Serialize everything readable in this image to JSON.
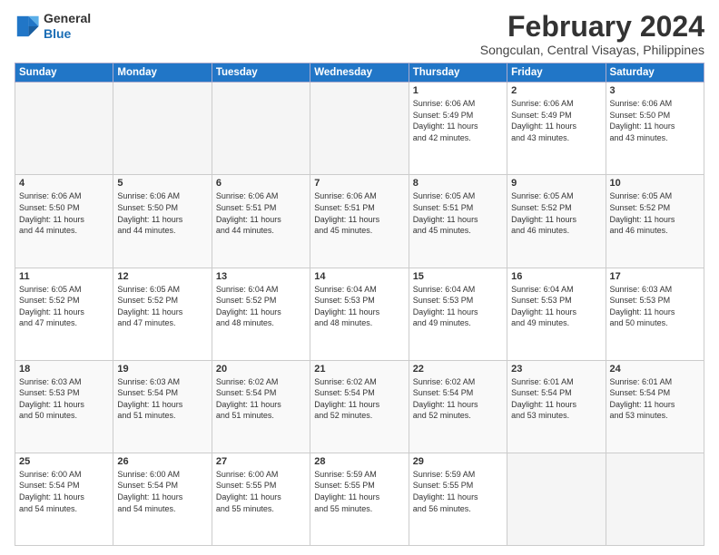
{
  "logo": {
    "line1": "General",
    "line2": "Blue"
  },
  "title": "February 2024",
  "subtitle": "Songculan, Central Visayas, Philippines",
  "days_header": [
    "Sunday",
    "Monday",
    "Tuesday",
    "Wednesday",
    "Thursday",
    "Friday",
    "Saturday"
  ],
  "weeks": [
    [
      {
        "day": "",
        "info": ""
      },
      {
        "day": "",
        "info": ""
      },
      {
        "day": "",
        "info": ""
      },
      {
        "day": "",
        "info": ""
      },
      {
        "day": "1",
        "info": "Sunrise: 6:06 AM\nSunset: 5:49 PM\nDaylight: 11 hours\nand 42 minutes."
      },
      {
        "day": "2",
        "info": "Sunrise: 6:06 AM\nSunset: 5:49 PM\nDaylight: 11 hours\nand 43 minutes."
      },
      {
        "day": "3",
        "info": "Sunrise: 6:06 AM\nSunset: 5:50 PM\nDaylight: 11 hours\nand 43 minutes."
      }
    ],
    [
      {
        "day": "4",
        "info": "Sunrise: 6:06 AM\nSunset: 5:50 PM\nDaylight: 11 hours\nand 44 minutes."
      },
      {
        "day": "5",
        "info": "Sunrise: 6:06 AM\nSunset: 5:50 PM\nDaylight: 11 hours\nand 44 minutes."
      },
      {
        "day": "6",
        "info": "Sunrise: 6:06 AM\nSunset: 5:51 PM\nDaylight: 11 hours\nand 44 minutes."
      },
      {
        "day": "7",
        "info": "Sunrise: 6:06 AM\nSunset: 5:51 PM\nDaylight: 11 hours\nand 45 minutes."
      },
      {
        "day": "8",
        "info": "Sunrise: 6:05 AM\nSunset: 5:51 PM\nDaylight: 11 hours\nand 45 minutes."
      },
      {
        "day": "9",
        "info": "Sunrise: 6:05 AM\nSunset: 5:52 PM\nDaylight: 11 hours\nand 46 minutes."
      },
      {
        "day": "10",
        "info": "Sunrise: 6:05 AM\nSunset: 5:52 PM\nDaylight: 11 hours\nand 46 minutes."
      }
    ],
    [
      {
        "day": "11",
        "info": "Sunrise: 6:05 AM\nSunset: 5:52 PM\nDaylight: 11 hours\nand 47 minutes."
      },
      {
        "day": "12",
        "info": "Sunrise: 6:05 AM\nSunset: 5:52 PM\nDaylight: 11 hours\nand 47 minutes."
      },
      {
        "day": "13",
        "info": "Sunrise: 6:04 AM\nSunset: 5:52 PM\nDaylight: 11 hours\nand 48 minutes."
      },
      {
        "day": "14",
        "info": "Sunrise: 6:04 AM\nSunset: 5:53 PM\nDaylight: 11 hours\nand 48 minutes."
      },
      {
        "day": "15",
        "info": "Sunrise: 6:04 AM\nSunset: 5:53 PM\nDaylight: 11 hours\nand 49 minutes."
      },
      {
        "day": "16",
        "info": "Sunrise: 6:04 AM\nSunset: 5:53 PM\nDaylight: 11 hours\nand 49 minutes."
      },
      {
        "day": "17",
        "info": "Sunrise: 6:03 AM\nSunset: 5:53 PM\nDaylight: 11 hours\nand 50 minutes."
      }
    ],
    [
      {
        "day": "18",
        "info": "Sunrise: 6:03 AM\nSunset: 5:53 PM\nDaylight: 11 hours\nand 50 minutes."
      },
      {
        "day": "19",
        "info": "Sunrise: 6:03 AM\nSunset: 5:54 PM\nDaylight: 11 hours\nand 51 minutes."
      },
      {
        "day": "20",
        "info": "Sunrise: 6:02 AM\nSunset: 5:54 PM\nDaylight: 11 hours\nand 51 minutes."
      },
      {
        "day": "21",
        "info": "Sunrise: 6:02 AM\nSunset: 5:54 PM\nDaylight: 11 hours\nand 52 minutes."
      },
      {
        "day": "22",
        "info": "Sunrise: 6:02 AM\nSunset: 5:54 PM\nDaylight: 11 hours\nand 52 minutes."
      },
      {
        "day": "23",
        "info": "Sunrise: 6:01 AM\nSunset: 5:54 PM\nDaylight: 11 hours\nand 53 minutes."
      },
      {
        "day": "24",
        "info": "Sunrise: 6:01 AM\nSunset: 5:54 PM\nDaylight: 11 hours\nand 53 minutes."
      }
    ],
    [
      {
        "day": "25",
        "info": "Sunrise: 6:00 AM\nSunset: 5:54 PM\nDaylight: 11 hours\nand 54 minutes."
      },
      {
        "day": "26",
        "info": "Sunrise: 6:00 AM\nSunset: 5:54 PM\nDaylight: 11 hours\nand 54 minutes."
      },
      {
        "day": "27",
        "info": "Sunrise: 6:00 AM\nSunset: 5:55 PM\nDaylight: 11 hours\nand 55 minutes."
      },
      {
        "day": "28",
        "info": "Sunrise: 5:59 AM\nSunset: 5:55 PM\nDaylight: 11 hours\nand 55 minutes."
      },
      {
        "day": "29",
        "info": "Sunrise: 5:59 AM\nSunset: 5:55 PM\nDaylight: 11 hours\nand 56 minutes."
      },
      {
        "day": "",
        "info": ""
      },
      {
        "day": "",
        "info": ""
      }
    ]
  ]
}
